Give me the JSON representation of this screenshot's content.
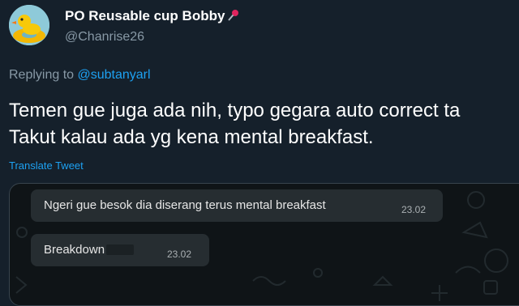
{
  "tweet": {
    "author": {
      "display_name": "PO Reusable cup Bobby",
      "handle": "@Chanrise26",
      "pin_icon": "pushpin-icon",
      "avatar_icon": "rubber-duck-float-avatar"
    },
    "replying_prefix": "Replying to",
    "replying_to": "@subtanyarl",
    "text_lines": [
      "Temen gue juga ada nih, typo gegara auto correct ta",
      "Takut kalau ada yg kena mental breakfast."
    ],
    "translate_label": "Translate Tweet"
  },
  "media": {
    "messages": [
      {
        "text": "Ngeri gue besok dia diserang terus mental breakfast",
        "time": "23.02"
      },
      {
        "text": "Breakdown",
        "time": "23.02",
        "censored": true
      }
    ]
  },
  "colors": {
    "background": "#15202b",
    "link": "#1da1f2",
    "muted": "#8899a6",
    "bubble": "#262d31"
  }
}
